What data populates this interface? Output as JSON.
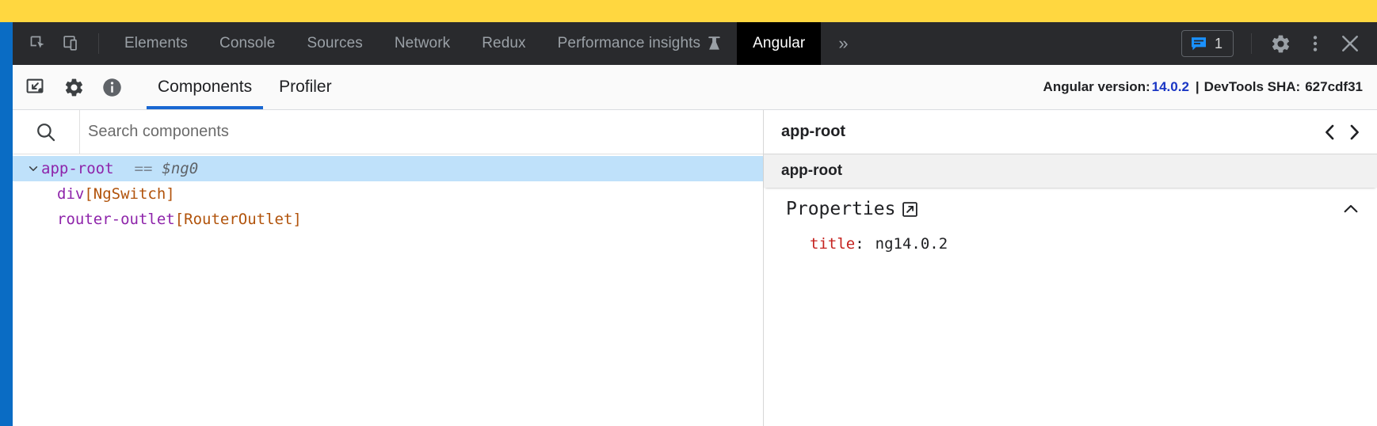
{
  "window": {
    "page_strip_color": "#ffd740",
    "accent_blue": "#0a6cc4"
  },
  "devtools_tabbar": {
    "left_icons": [
      {
        "name": "inspect-element-icon",
        "label": "Inspect element"
      },
      {
        "name": "device-toolbar-icon",
        "label": "Toggle device toolbar"
      }
    ],
    "tabs": [
      {
        "label": "Elements",
        "selected": false,
        "experimental": false
      },
      {
        "label": "Console",
        "selected": false,
        "experimental": false
      },
      {
        "label": "Sources",
        "selected": false,
        "experimental": false
      },
      {
        "label": "Network",
        "selected": false,
        "experimental": false
      },
      {
        "label": "Redux",
        "selected": false,
        "experimental": false
      },
      {
        "label": "Performance insights",
        "selected": false,
        "experimental": true
      },
      {
        "label": "Angular",
        "selected": true,
        "experimental": false
      }
    ],
    "more_tabs_label": "»",
    "issues": {
      "icon": "issues-message-icon",
      "icon_color": "#1a91ff",
      "count": "1"
    },
    "right_icons": [
      {
        "name": "settings-gear-icon",
        "label": "Settings"
      },
      {
        "name": "more-options-icon",
        "label": "Customize and control DevTools"
      },
      {
        "name": "close-devtools-icon",
        "label": "Close DevTools"
      }
    ]
  },
  "angular_toolbar": {
    "icons": [
      {
        "name": "component-inspector-icon",
        "label": "Inspect component"
      },
      {
        "name": "settings-gear-icon",
        "label": "Settings"
      },
      {
        "name": "info-icon",
        "label": "About"
      }
    ],
    "tabs": [
      {
        "label": "Components",
        "active": true
      },
      {
        "label": "Profiler",
        "active": false
      }
    ],
    "version_info": {
      "angular_label": "Angular version:",
      "angular_version": "14.0.2",
      "separator": "|",
      "devtools_sha_label": "DevTools SHA:",
      "devtools_sha": "627cdf31",
      "version_color": "#1a36c4"
    }
  },
  "component_tree": {
    "search": {
      "icon": "search-icon",
      "placeholder": "Search components",
      "value": ""
    },
    "nodes": [
      {
        "depth": 0,
        "expandable": true,
        "expanded": true,
        "chevron": "⌄",
        "tag": "app-root",
        "directive": "",
        "eq": "==",
        "ref": "$ng0",
        "selected": true
      },
      {
        "depth": 1,
        "expandable": false,
        "expanded": false,
        "chevron": "",
        "tag": "div",
        "directive": "[NgSwitch]",
        "eq": "",
        "ref": "",
        "selected": false
      },
      {
        "depth": 1,
        "expandable": false,
        "expanded": false,
        "chevron": "",
        "tag": "router-outlet",
        "directive": "[RouterOutlet]",
        "eq": "",
        "ref": "",
        "selected": false
      }
    ]
  },
  "detail_panel": {
    "header_title": "app-root",
    "nav_prev_icon": "chevron-left-icon",
    "nav_next_icon": "chevron-right-icon",
    "subheader_title": "app-root",
    "properties": {
      "title": "Properties",
      "open_in_new_icon": "open-in-new-icon",
      "collapse_icon": "chevron-up-icon",
      "rows": [
        {
          "key": "title",
          "colon": ":",
          "value": "ng14.0.2"
        }
      ]
    }
  }
}
